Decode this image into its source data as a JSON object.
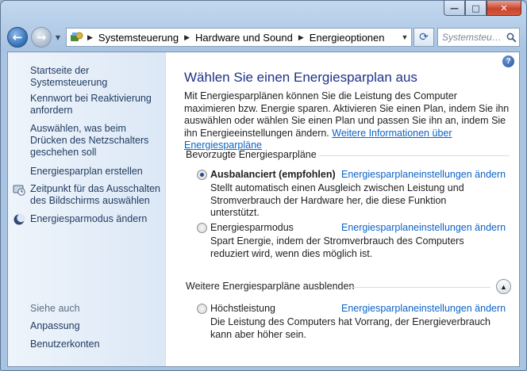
{
  "window": {
    "caption_buttons": {
      "minimize": "—",
      "maximize": "□",
      "close": "✕"
    }
  },
  "address": {
    "crumbs": [
      "Systemsteuerung",
      "Hardware und Sound",
      "Energieoptionen"
    ],
    "search_placeholder": "Systemsteu…"
  },
  "sidebar": {
    "home_link": "Startseite der Systemsteuerung",
    "links": [
      {
        "label": "Kennwort bei Reaktivierung anfordern",
        "icon": "none"
      },
      {
        "label": "Auswählen, was beim Drücken des Netzschalters geschehen soll",
        "icon": "none"
      },
      {
        "label": "Energiesparplan erstellen",
        "icon": "none"
      },
      {
        "label": "Zeitpunkt für das Ausschalten des Bildschirms auswählen",
        "icon": "monitor-clock-icon"
      },
      {
        "label": "Energiesparmodus ändern",
        "icon": "moon-icon"
      }
    ],
    "see_also_heading": "Siehe auch",
    "see_also": [
      "Anpassung",
      "Benutzerkonten"
    ]
  },
  "main": {
    "title": "Wählen Sie einen Energiesparplan aus",
    "intro_text": "Mit Energiesparplänen können Sie die Leistung des Computer maximieren bzw. Energie sparen. Aktivieren Sie einen Plan, indem Sie ihn auswählen oder wählen Sie einen Plan und passen Sie ihn an, indem Sie ihn Energieeinstellungen ändern.",
    "intro_link": "Weitere Informationen über Energiesparpläne",
    "preferred_heading": "Bevorzugte Energiesparpläne",
    "more_heading": "Weitere Energiesparpläne ausblenden",
    "plans": [
      {
        "name": "Ausbalanciert (empfohlen)",
        "selected": true,
        "link": "Energiesparplaneinstellungen ändern",
        "description": "Stellt automatisch einen Ausgleich zwischen Leistung und Stromverbrauch der Hardware her, die diese Funktion unterstützt."
      },
      {
        "name": "Energiesparmodus",
        "selected": false,
        "link": "Energiesparplaneinstellungen ändern",
        "description": "Spart Energie, indem der Stromverbrauch des Computers reduziert wird, wenn dies möglich ist."
      },
      {
        "name": "Höchstleistung",
        "selected": false,
        "link": "Energiesparplaneinstellungen ändern",
        "description": "Die Leistung des Computers hat Vorrang, der Energieverbrauch kann aber höher sein."
      }
    ]
  },
  "colors": {
    "link": "#0a63c7",
    "title": "#1e3287",
    "sidebar_text": "#1e3a5f"
  }
}
